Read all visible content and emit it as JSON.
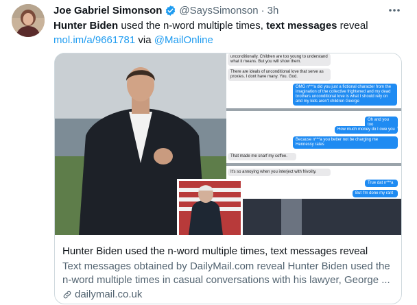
{
  "tweet": {
    "author_name": "Joe Gabriel Simonson",
    "handle": "@SaysSimonson",
    "separator": "·",
    "time": "3h",
    "more_label": "···",
    "text_part1_bold": "Hunter Biden",
    "text_part2": " used the n-word multiple times, ",
    "text_part3_bold": "text messages",
    "text_part4": " reveal",
    "link": "mol.im/a/9661781",
    "via": " via ",
    "mention": "@MailOnline"
  },
  "card": {
    "title": "Hunter Biden used the n-word multiple times, text messages reveal",
    "description_line1": "Text messages obtained by DailyMail.com reveal Hunter Biden used the",
    "description_line2": "n-word multiple times in casual conversations with his lawyer, George ...",
    "domain": "dailymail.co.uk",
    "messages": [
      {
        "dir": "in",
        "text": "unconditionally. Children are too young to understand what it means. But you will show them."
      },
      {
        "dir": "in",
        "text": "There are ideals of unconditional love that serve as proxies. I dont have many. You. God."
      },
      {
        "dir": "out",
        "text": "OMG n***a did you just a fictional character from the imagination of the collective frightened and my dead brothers unconditional love is what I should rely on and my kids aren't children George"
      },
      {
        "dir": "out",
        "text": "Oh and you too"
      },
      {
        "dir": "out",
        "text": "How much money do I owe you"
      },
      {
        "dir": "out",
        "text": "Because n***a you better not be charging me Hennessy rates"
      },
      {
        "dir": "in",
        "text": "That made me snarf my coffee."
      },
      {
        "dir": "in",
        "text": "It's so annoying when you interject with frivolity."
      },
      {
        "dir": "out",
        "text": "True dat n***a"
      },
      {
        "dir": "out",
        "text": "But I'm done my rant"
      }
    ]
  },
  "colors": {
    "link": "#1d9bf0",
    "secondary_text": "#536471",
    "verified_badge": "#1d9bf0",
    "imessage_blue": "#1f8bf2"
  },
  "icons": {
    "verified": "verified-badge-icon",
    "more": "more-options-icon",
    "link": "link-icon"
  }
}
